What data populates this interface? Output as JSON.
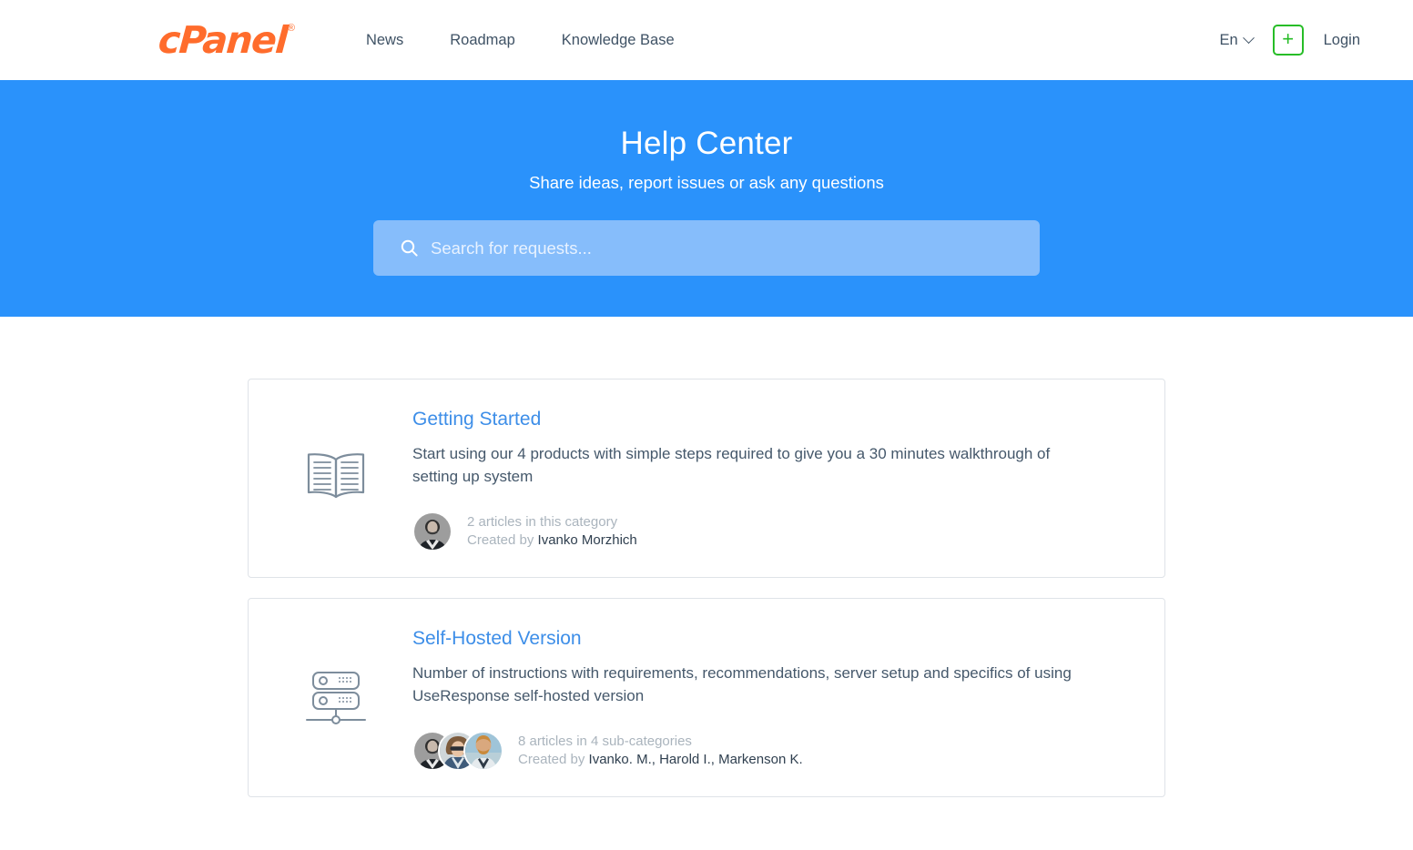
{
  "header": {
    "brand": {
      "name": "cPanel",
      "trademark": "®",
      "color": "#ff6c2c"
    },
    "nav": [
      {
        "label": "News",
        "name": "news"
      },
      {
        "label": "Roadmap",
        "name": "roadmap"
      },
      {
        "label": "Knowledge Base",
        "name": "knowledge-base"
      }
    ],
    "language": {
      "label": "En",
      "icon": "chevron-down-icon"
    },
    "add_button": {
      "label": "+",
      "icon": "plus-icon",
      "color": "#27bd27"
    },
    "login": {
      "label": "Login"
    }
  },
  "hero": {
    "title": "Help Center",
    "subtitle": "Share ideas, report issues or ask any questions",
    "background_color": "#2a92fb",
    "search": {
      "icon": "search-icon",
      "placeholder": "Search for requests...",
      "value": "",
      "background_color": "#86bdfb"
    }
  },
  "categories": [
    {
      "icon": "open-book-icon",
      "title": "Getting Started",
      "description": "Start using our 4 products with simple steps required to give you a 30 minutes walkthrough of setting up system",
      "article_count": "2 articles in this category",
      "created_by_label": "Created by",
      "authors": "Ivanko Morzhich",
      "avatar_count": 1
    },
    {
      "icon": "server-icon",
      "title": "Self-Hosted Version",
      "description": "Number of instructions with requirements, recommendations, server setup and specifics of using UseResponse self-hosted version",
      "article_count": "8 articles in 4 sub-categories",
      "created_by_label": "Created by",
      "authors": "Ivanko. M., Harold I., Markenson K.",
      "avatar_count": 3
    }
  ],
  "theme": {
    "accent_blue": "#2a92fb",
    "link_blue": "#3d8ee8",
    "text_slate": "#45586b",
    "muted_gray": "#aab4bd",
    "brand_orange": "#ff6c2c",
    "green": "#27bd27"
  }
}
